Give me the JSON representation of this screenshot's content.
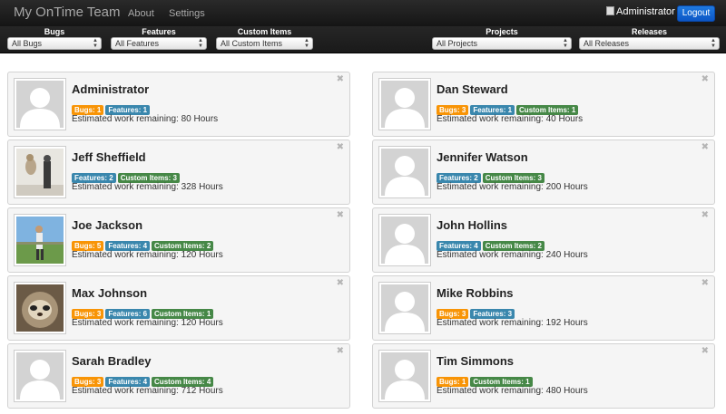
{
  "header": {
    "title": "My OnTime Team",
    "nav": [
      "About",
      "Settings"
    ],
    "user": "Administrator",
    "logout_label": "Logout"
  },
  "filters": [
    {
      "label": "Bugs",
      "value": "All Bugs"
    },
    {
      "label": "Features",
      "value": "All Features"
    },
    {
      "label": "Custom Items",
      "value": "All Custom Items"
    },
    {
      "label": "Projects",
      "value": "All Projects"
    },
    {
      "label": "Releases",
      "value": "All Releases"
    }
  ],
  "members": [
    {
      "name": "Administrator",
      "avatar": "placeholder-avatar",
      "badges": [
        {
          "type": "bugs",
          "text": "Bugs: 1"
        },
        {
          "type": "features",
          "text": "Features: 1"
        }
      ],
      "work": "Estimated work remaining: 80 Hours"
    },
    {
      "name": "Dan Steward",
      "avatar": "placeholder-avatar",
      "badges": [
        {
          "type": "bugs",
          "text": "Bugs: 3"
        },
        {
          "type": "features",
          "text": "Features: 1"
        },
        {
          "type": "custom",
          "text": "Custom Items: 1"
        }
      ],
      "work": "Estimated work remaining: 40 Hours"
    },
    {
      "name": "Jeff Sheffield",
      "avatar": "photo-figure",
      "badges": [
        {
          "type": "features",
          "text": "Features: 2"
        },
        {
          "type": "custom",
          "text": "Custom Items: 3"
        }
      ],
      "work": "Estimated work remaining: 328 Hours"
    },
    {
      "name": "Jennifer Watson",
      "avatar": "placeholder-avatar",
      "badges": [
        {
          "type": "features",
          "text": "Features: 2"
        },
        {
          "type": "custom",
          "text": "Custom Items: 3"
        }
      ],
      "work": "Estimated work remaining: 200 Hours"
    },
    {
      "name": "Joe Jackson",
      "avatar": "photo-golf",
      "badges": [
        {
          "type": "bugs",
          "text": "Bugs: 5"
        },
        {
          "type": "features",
          "text": "Features: 4"
        },
        {
          "type": "custom",
          "text": "Custom Items: 2"
        }
      ],
      "work": "Estimated work remaining: 120 Hours"
    },
    {
      "name": "John Hollins",
      "avatar": "placeholder-avatar",
      "badges": [
        {
          "type": "features",
          "text": "Features: 4"
        },
        {
          "type": "custom",
          "text": "Custom Items: 2"
        }
      ],
      "work": "Estimated work remaining: 240 Hours"
    },
    {
      "name": "Max Johnson",
      "avatar": "photo-sloth",
      "badges": [
        {
          "type": "bugs",
          "text": "Bugs: 3"
        },
        {
          "type": "features",
          "text": "Features: 6"
        },
        {
          "type": "custom",
          "text": "Custom Items: 1"
        }
      ],
      "work": "Estimated work remaining: 120 Hours"
    },
    {
      "name": "Mike Robbins",
      "avatar": "placeholder-avatar",
      "badges": [
        {
          "type": "bugs",
          "text": "Bugs: 3"
        },
        {
          "type": "features",
          "text": "Features: 3"
        }
      ],
      "work": "Estimated work remaining: 192 Hours"
    },
    {
      "name": "Sarah Bradley",
      "avatar": "placeholder-avatar",
      "badges": [
        {
          "type": "bugs",
          "text": "Bugs: 3"
        },
        {
          "type": "features",
          "text": "Features: 4"
        },
        {
          "type": "custom",
          "text": "Custom Items: 4"
        }
      ],
      "work": "Estimated work remaining: 712 Hours"
    },
    {
      "name": "Tim Simmons",
      "avatar": "placeholder-avatar",
      "badges": [
        {
          "type": "bugs",
          "text": "Bugs: 1"
        },
        {
          "type": "custom",
          "text": "Custom Items: 1"
        }
      ],
      "work": "Estimated work remaining: 480 Hours"
    }
  ],
  "colors": {
    "bugs": "#f89406",
    "features": "#3a87ad",
    "custom": "#468847",
    "logout": "#1366d6"
  }
}
